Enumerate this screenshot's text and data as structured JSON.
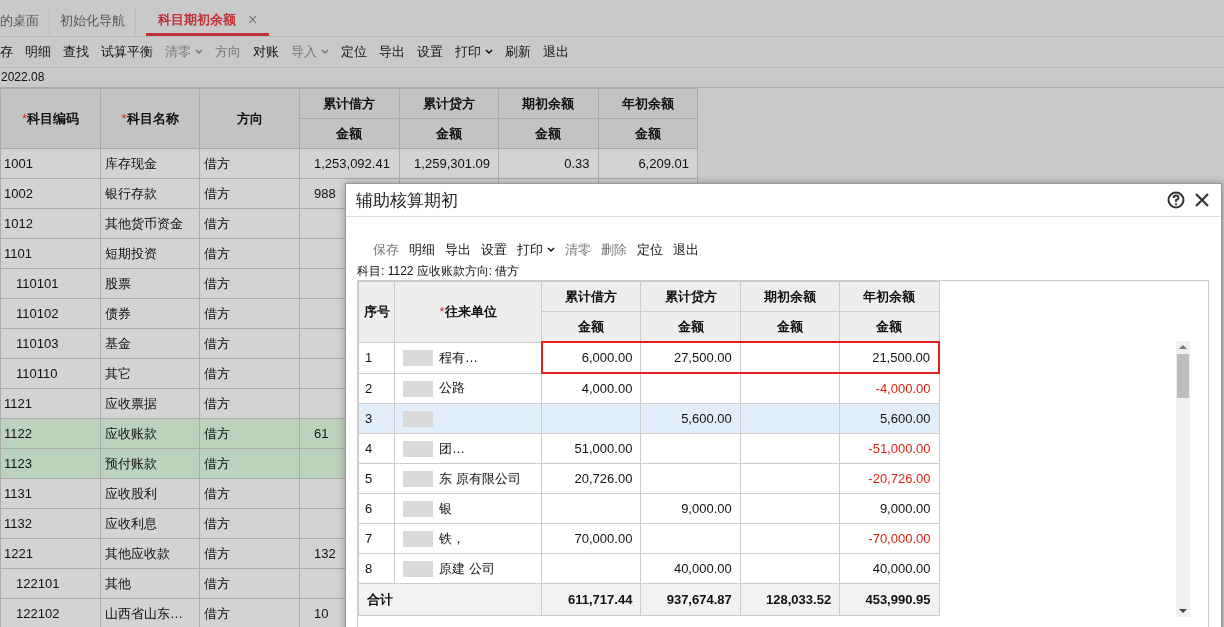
{
  "tabs": [
    {
      "label": "的桌面",
      "selected": false,
      "closable": false
    },
    {
      "label": "初始化导航",
      "selected": false,
      "closable": false
    },
    {
      "label": "科目期初余额",
      "selected": true,
      "closable": true
    }
  ],
  "close_glyph": "×",
  "required_mark": "*",
  "toolbar": [
    {
      "label": "存",
      "disabled": false,
      "menu": false
    },
    {
      "label": "明细",
      "disabled": false,
      "menu": false
    },
    {
      "label": "查找",
      "disabled": false,
      "menu": false
    },
    {
      "label": "试算平衡",
      "disabled": false,
      "menu": false
    },
    {
      "label": "清零",
      "disabled": true,
      "menu": true
    },
    {
      "label": "方向",
      "disabled": true,
      "menu": false
    },
    {
      "label": "对账",
      "disabled": false,
      "menu": false
    },
    {
      "label": "导入",
      "disabled": true,
      "menu": true
    },
    {
      "label": "定位",
      "disabled": false,
      "menu": false
    },
    {
      "label": "导出",
      "disabled": false,
      "menu": false
    },
    {
      "label": "设置",
      "disabled": false,
      "menu": false
    },
    {
      "label": "打印",
      "disabled": false,
      "menu": true
    },
    {
      "label": "刷新",
      "disabled": false,
      "menu": false
    },
    {
      "label": "退出",
      "disabled": false,
      "menu": false
    }
  ],
  "period": "2022.08",
  "table": {
    "columns": [
      {
        "label": "科目编码",
        "required": true
      },
      {
        "label": "科目名称",
        "required": true
      },
      {
        "label": "方向",
        "required": false
      }
    ],
    "groups": [
      {
        "label": "累计借方",
        "sub": "金额"
      },
      {
        "label": "累计贷方",
        "sub": "金额"
      },
      {
        "label": "期初余额",
        "sub": "金额"
      },
      {
        "label": "年初余额",
        "sub": "金额"
      }
    ],
    "rows": [
      {
        "code": "1001",
        "name": "库存现金",
        "dir": "借方",
        "values": {
          "debit": "1,253,092.41",
          "credit": "1,259,301.09",
          "opening": "0.33",
          "year_start": "6,209.01"
        },
        "selected": false
      },
      {
        "code": "1002",
        "name": "银行存款",
        "dir": "借方",
        "values": {
          "debit": "988"
        },
        "selected": false
      },
      {
        "code": "1012",
        "name": "其他货币资金",
        "dir": "借方",
        "selected": false
      },
      {
        "code": "1101",
        "name": "短期投资",
        "dir": "借方",
        "selected": false,
        "children": [
          {
            "code": "110101",
            "name": "股票",
            "dir": "借方",
            "selected": false
          },
          {
            "code": "110102",
            "name": "债券",
            "dir": "借方",
            "selected": false
          },
          {
            "code": "110103",
            "name": "基金",
            "dir": "借方",
            "selected": false
          },
          {
            "code": "110110",
            "name": "其它",
            "dir": "借方",
            "selected": false
          }
        ]
      },
      {
        "code": "1121",
        "name": "应收票据",
        "dir": "借方",
        "selected": false
      },
      {
        "code": "1122",
        "name": "应收账款",
        "dir": "借方",
        "values": {
          "debit": "61"
        },
        "selected": true
      },
      {
        "code": "1123",
        "name": "预付账款",
        "dir": "借方",
        "selected": true
      },
      {
        "code": "1131",
        "name": "应收股利",
        "dir": "借方",
        "selected": false
      },
      {
        "code": "1132",
        "name": "应收利息",
        "dir": "借方",
        "selected": false
      },
      {
        "code": "1221",
        "name": "其他应收款",
        "dir": "借方",
        "values": {
          "debit": "132"
        },
        "selected": false,
        "children": [
          {
            "code": "122101",
            "name": "其他",
            "dir": "借方",
            "selected": false
          },
          {
            "code": "122102",
            "name": "山西省山东…",
            "dir": "借方",
            "values": {
              "debit": "10"
            },
            "selected": false
          }
        ]
      }
    ]
  },
  "dialog": {
    "title": "辅助核算期初",
    "toolbar": [
      {
        "label": "保存",
        "disabled": true,
        "menu": false
      },
      {
        "label": "明细",
        "disabled": false,
        "menu": false
      },
      {
        "label": "导出",
        "disabled": false,
        "menu": false
      },
      {
        "label": "设置",
        "disabled": false,
        "menu": false
      },
      {
        "label": "打印",
        "disabled": false,
        "menu": true
      },
      {
        "label": "清零",
        "disabled": true,
        "menu": false
      },
      {
        "label": "删除",
        "disabled": true,
        "menu": false
      },
      {
        "label": "定位",
        "disabled": false,
        "menu": false
      },
      {
        "label": "退出",
        "disabled": false,
        "menu": false
      }
    ],
    "info": "科目: 1122 应收账款方向: 借方",
    "columns": [
      {
        "label": "序号",
        "required": false
      },
      {
        "label": "往来单位",
        "required": true
      }
    ],
    "groups": [
      {
        "label": "累计借方",
        "sub": "金额"
      },
      {
        "label": "累计贷方",
        "sub": "金额"
      },
      {
        "label": "期初余额",
        "sub": "金额"
      },
      {
        "label": "年初余额",
        "sub": "金额"
      }
    ],
    "rows": [
      {
        "no": "1",
        "unit": "程有…",
        "values": {
          "debit": "6,000.00",
          "credit": "27,500.00",
          "year_start": "21,500.00"
        },
        "negative": false,
        "selected": false,
        "highlighted": true
      },
      {
        "no": "2",
        "unit": "公路",
        "values": {
          "debit": "4,000.00",
          "year_start": "-4,000.00"
        },
        "negative": true,
        "selected": false,
        "highlighted": false
      },
      {
        "no": "3",
        "values": {
          "credit": "5,600.00",
          "year_start": "5,600.00"
        },
        "negative": false,
        "selected": true,
        "highlighted": false
      },
      {
        "no": "4",
        "unit": "团…",
        "values": {
          "debit": "51,000.00",
          "year_start": "-51,000.00"
        },
        "negative": true,
        "selected": false,
        "highlighted": false
      },
      {
        "no": "5",
        "unit": "东 原有限公司",
        "values": {
          "debit": "20,726.00",
          "year_start": "-20,726.00"
        },
        "negative": true,
        "selected": false,
        "highlighted": false
      },
      {
        "no": "6",
        "unit": "银",
        "values": {
          "credit": "9,000.00",
          "year_start": "9,000.00"
        },
        "negative": false,
        "selected": false,
        "highlighted": false
      },
      {
        "no": "7",
        "unit": "铁，",
        "values": {
          "debit": "70,000.00",
          "year_start": "-70,000.00"
        },
        "negative": true,
        "selected": false,
        "highlighted": false
      },
      {
        "no": "8",
        "unit": "原建 公司",
        "values": {
          "credit": "40,000.00",
          "year_start": "40,000.00"
        },
        "negative": false,
        "selected": false,
        "highlighted": false
      }
    ],
    "total": {
      "label": "合计",
      "values": {
        "debit": "611,717.44",
        "credit": "937,674.87",
        "opening": "128,033.52",
        "year_start": "453,990.95"
      }
    }
  }
}
